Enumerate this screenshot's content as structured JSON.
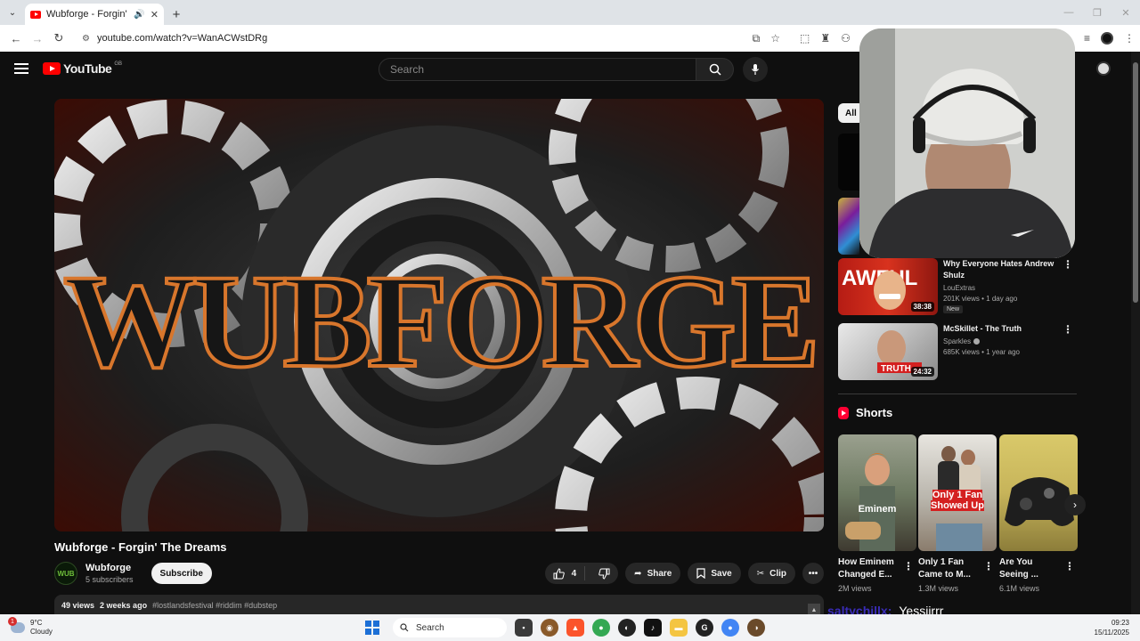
{
  "browser": {
    "tab_title": "Wubforge - Forgin' The Dre",
    "url": "youtube.com/watch?v=WanACWstDRg"
  },
  "header": {
    "logo_text": "YouTube",
    "country_code": "GB",
    "search_placeholder": "Search"
  },
  "video": {
    "banner_text": "WUBFORGE",
    "title": "Wubforge - Forgin' The Dreams",
    "channel_name": "Wubforge",
    "channel_avatar_text": "WUB",
    "subscribers": "5 subscribers",
    "subscribe_label": "Subscribe",
    "like_count": "4",
    "share_label": "Share",
    "save_label": "Save",
    "clip_label": "Clip",
    "views": "49 views",
    "age": "2 weeks ago",
    "tags": "#lostlandsfestival #riddim #dubstep"
  },
  "sidebar": {
    "chip_all": "All",
    "recommendations": [
      {
        "title": "Why Everyone Hates Andrew Shulz",
        "channel": "LouExtras",
        "views": "201K views",
        "age": "1 day ago",
        "badge": "New",
        "duration": "38:38",
        "thumb_text": "AWFUL"
      },
      {
        "title": "McSkillet - The Truth",
        "channel": "Sparkles",
        "views": "685K views",
        "age": "1 year ago",
        "duration": "24:32",
        "thumb_text": "TRUTH"
      }
    ],
    "shorts_heading": "Shorts",
    "shorts": [
      {
        "title": "How Eminem Changed E...",
        "views": "2M views",
        "overlay": "Eminem"
      },
      {
        "title": "Only 1 Fan Came to M...",
        "views": "1.3M views",
        "overlay": "Only 1 Fan Showed Up"
      },
      {
        "title": "Are You Seeing ...",
        "views": "6.1M views",
        "overlay": ""
      }
    ]
  },
  "chat": {
    "user": "saltychillx:",
    "message": "Yessiirrr"
  },
  "taskbar": {
    "weather_temp": "9°C",
    "weather_desc": "Cloudy",
    "alert_count": "1",
    "search_label": "Search",
    "time": "09:23",
    "date": "15/11/2025"
  },
  "colors": {
    "yt_red": "#ff0000",
    "background": "#0f0f0f",
    "chat_user": "#3a2cb8"
  }
}
